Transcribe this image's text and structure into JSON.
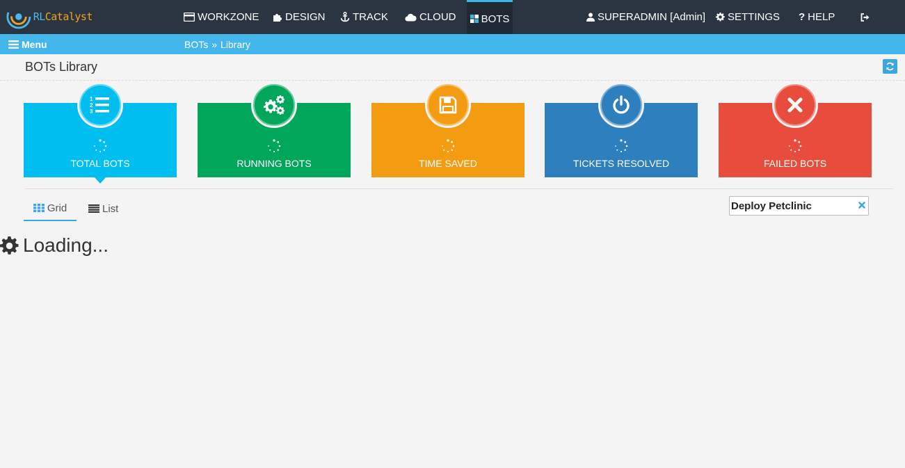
{
  "app": {
    "logo_rl": "RL",
    "logo_catalyst": "Catalyst"
  },
  "nav": {
    "workzone": "WORKZONE",
    "design": "DESIGN",
    "track": "TRACK",
    "cloud": "CLOUD",
    "bots": "BOTS",
    "user": "SUPERADMIN [Admin]",
    "settings": "SETTINGS",
    "help": "HELP"
  },
  "subbar": {
    "menu": "Menu",
    "breadcrumb": [
      "BOTs",
      "Library"
    ],
    "breadcrumb_sep": "»"
  },
  "page": {
    "title": "BOTs Library"
  },
  "cards": [
    {
      "label": "TOTAL BOTS",
      "icon": "ordered-list-icon",
      "color": "#00bff0"
    },
    {
      "label": "RUNNING BOTS",
      "icon": "gears-icon",
      "color": "#00a65a"
    },
    {
      "label": "TIME SAVED",
      "icon": "floppy-disk-icon",
      "color": "#f39c12"
    },
    {
      "label": "TICKETS RESOLVED",
      "icon": "power-icon",
      "color": "#2e7fbd"
    },
    {
      "label": "FAILED BOTS",
      "icon": "close-icon",
      "color": "#e74c3c"
    }
  ],
  "views": {
    "grid": "Grid",
    "list": "List"
  },
  "search": {
    "value": "Deploy Petclinic"
  },
  "status": {
    "loading": "Loading..."
  }
}
